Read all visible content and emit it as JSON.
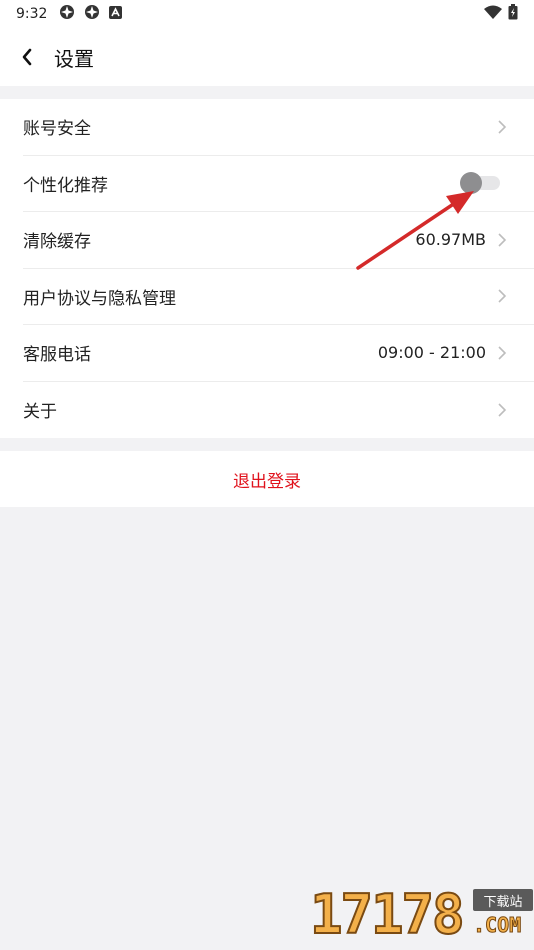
{
  "status_bar": {
    "time": "9:32"
  },
  "header": {
    "title": "设置"
  },
  "settings": {
    "items": [
      {
        "label": "账号安全"
      },
      {
        "label": "个性化推荐",
        "toggle_on": false
      },
      {
        "label": "清除缓存",
        "value": "60.97MB"
      },
      {
        "label": "用户协议与隐私管理"
      },
      {
        "label": "客服电话",
        "value": "09:00 - 21:00"
      },
      {
        "label": "关于"
      }
    ]
  },
  "logout": {
    "label": "退出登录"
  },
  "colors": {
    "accent": "#e0121c",
    "background": "#f2f2f4",
    "annotation_arrow": "#d42a2a"
  },
  "watermark": {
    "digits": "17178",
    "badge": "下载站",
    "suffix": ".COM"
  }
}
